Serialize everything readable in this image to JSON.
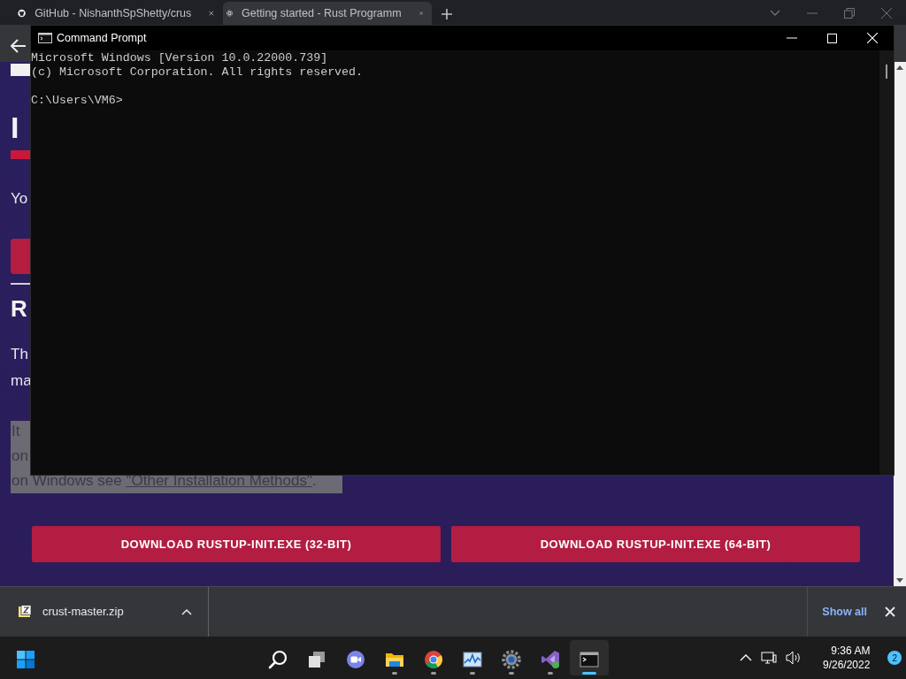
{
  "browser": {
    "tabs": [
      {
        "title": "GitHub - NishanthSpShetty/crus",
        "selected": false
      },
      {
        "title": "Getting started - Rust Programm",
        "selected": true
      }
    ],
    "page": {
      "heading": "I",
      "intro": "Yo",
      "section_heading": "R",
      "paragraph_lines": [
        "Th",
        "ma"
      ],
      "note_lines": [
        "It",
        "on"
      ],
      "note_last": "on Windows see ",
      "note_link": "\"Other Installation Methods\"",
      "note_end": ".",
      "buttons": [
        "DOWNLOAD RUSTUP-INIT.EXE (32-BIT)",
        "DOWNLOAD RUSTUP-INIT.EXE (64-BIT)"
      ]
    },
    "downloads": {
      "file": "crust-master.zip",
      "show_all": "Show all"
    }
  },
  "console": {
    "title": "Command Prompt",
    "lines": [
      "Microsoft Windows [Version 10.0.22000.739]",
      "(c) Microsoft Corporation. All rights reserved."
    ],
    "prompt": "C:\\Users\\VM6>"
  },
  "taskbar": {
    "apps": [
      {
        "kind": "start",
        "running": false,
        "active": false
      },
      {
        "kind": "search",
        "running": false,
        "active": false
      },
      {
        "kind": "taskview",
        "running": false,
        "active": false
      },
      {
        "kind": "chat",
        "running": false,
        "active": false
      },
      {
        "kind": "folder",
        "running": true,
        "active": false
      },
      {
        "kind": "browser",
        "running": true,
        "active": false
      },
      {
        "kind": "monitor",
        "running": true,
        "active": false
      },
      {
        "kind": "settings",
        "running": true,
        "active": false
      },
      {
        "kind": "studio",
        "running": true,
        "active": false
      },
      {
        "kind": "terminal",
        "running": true,
        "active": true
      }
    ],
    "time": "9:36 AM",
    "date": "9/26/2022",
    "notifications": "2"
  }
}
